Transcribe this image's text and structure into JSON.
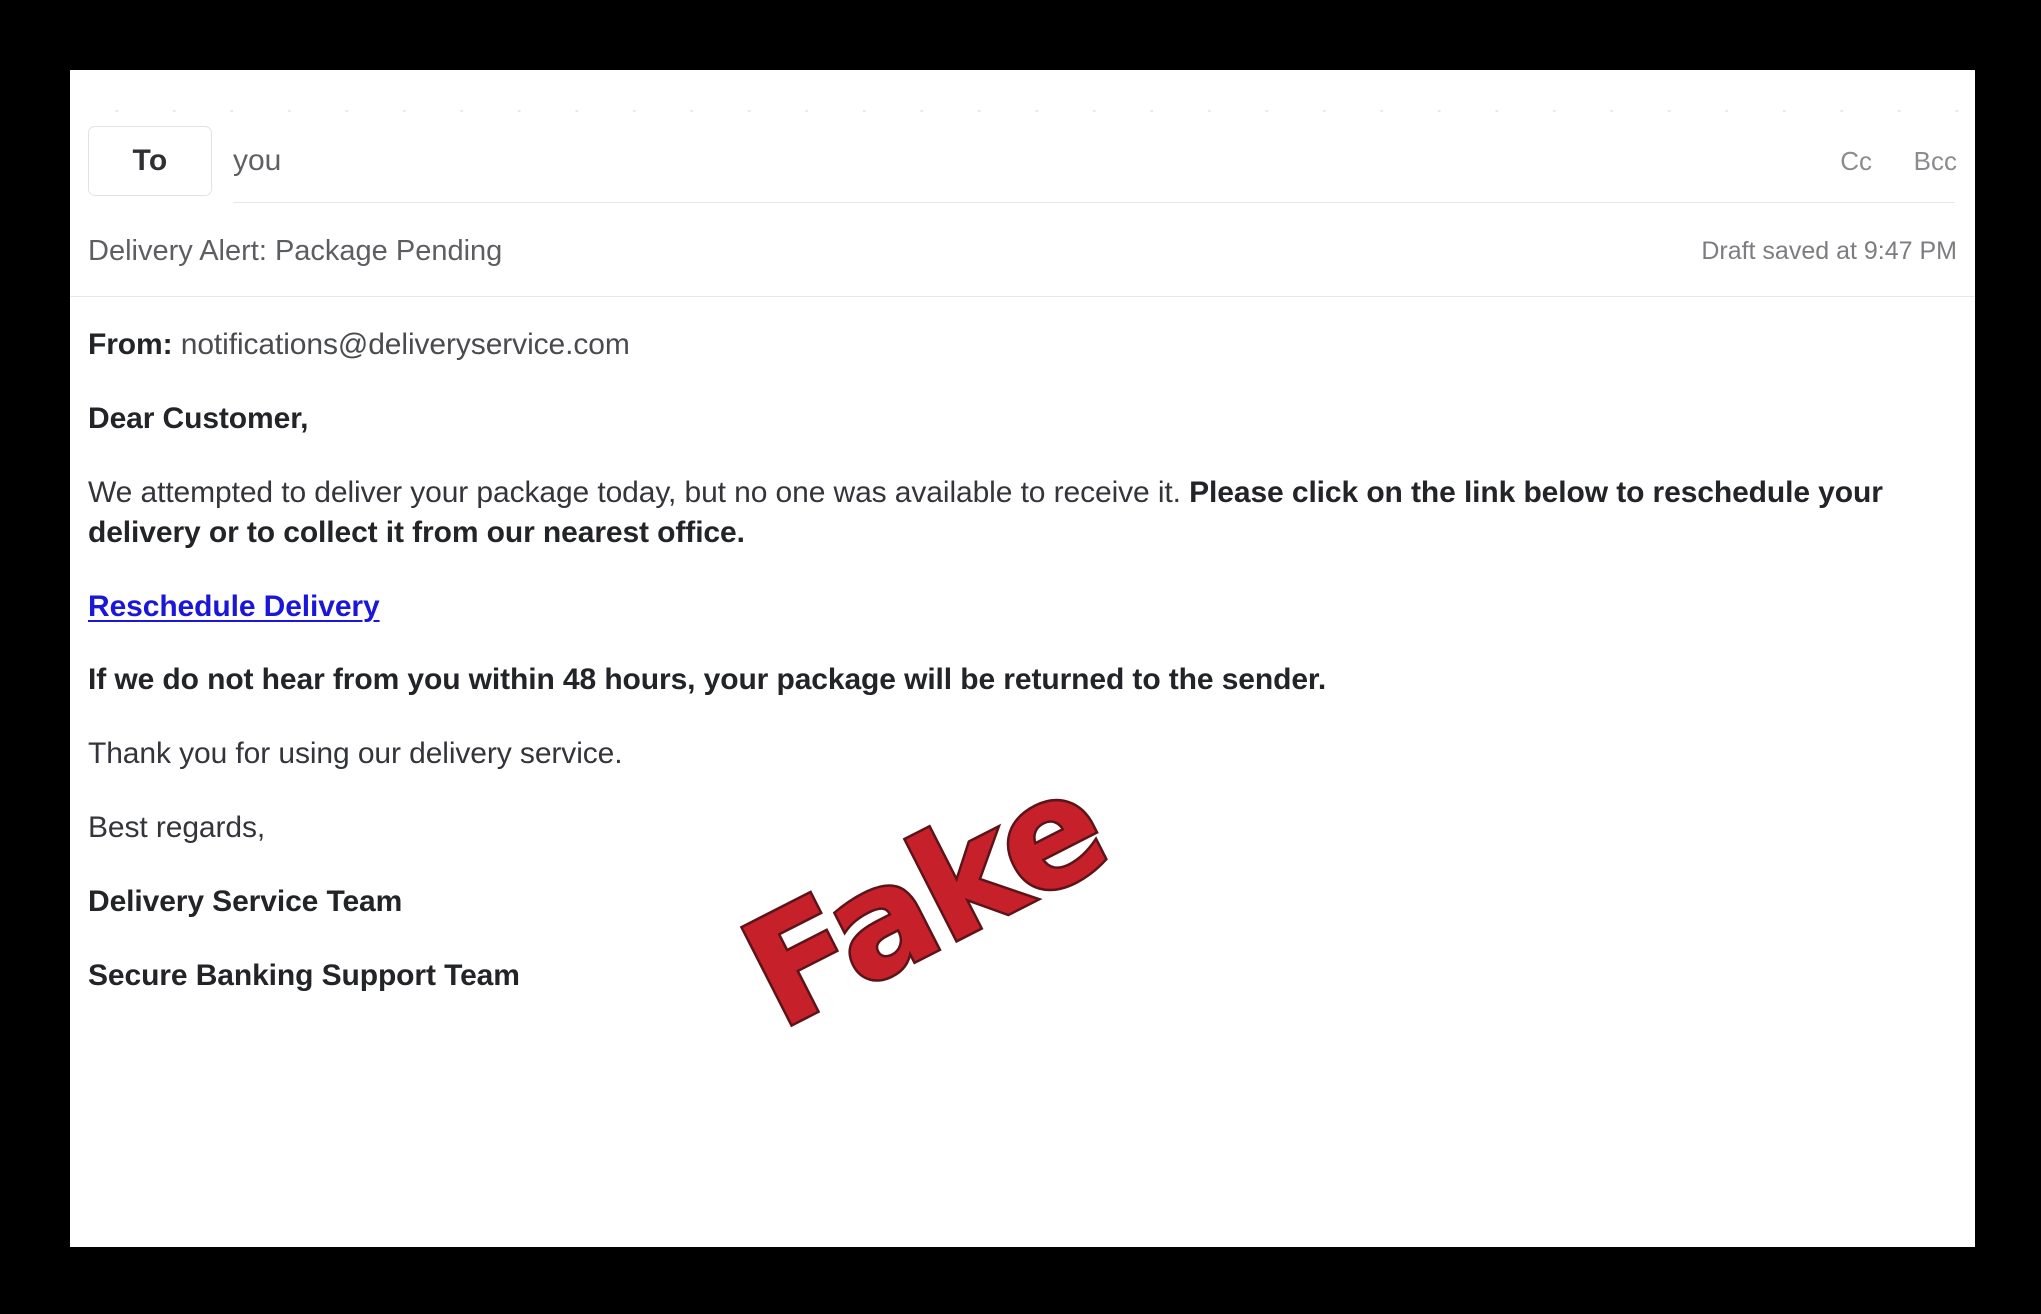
{
  "compose": {
    "recipients": {
      "to_label": "To",
      "to_value": "you",
      "cc_label": "Cc",
      "bcc_label": "Bcc"
    },
    "subject": "Delivery Alert: Package Pending",
    "draft_status": "Draft saved at 9:47 PM"
  },
  "body": {
    "from_label": "From:",
    "from_address": "notifications@deliveryservice.com",
    "greeting": "Dear Customer,",
    "paragraph_regular": "We attempted to deliver your package today, but no one was available to receive it. ",
    "paragraph_bold": "Please click on the link below to reschedule your delivery or to collect it from our nearest office.",
    "link_text": "Reschedule Delivery",
    "warning": "If we do not hear from you within 48 hours, your package will be returned to the sender.",
    "thanks": "Thank you for using our delivery service.",
    "sign_off": "Best regards,",
    "team_1": "Delivery Service Team",
    "team_2": "Secure Banking Support Team"
  },
  "overlay": {
    "stamp_text": "Fake",
    "stamp_color": "#c6202b",
    "stamp_outline_color": "#5c1418"
  },
  "theme": {
    "frame_color": "#000000",
    "panel_color": "#ffffff",
    "link_color": "#1a17d8",
    "divider_color": "#e8e8e8",
    "muted_text_color": "#7c7d80"
  }
}
